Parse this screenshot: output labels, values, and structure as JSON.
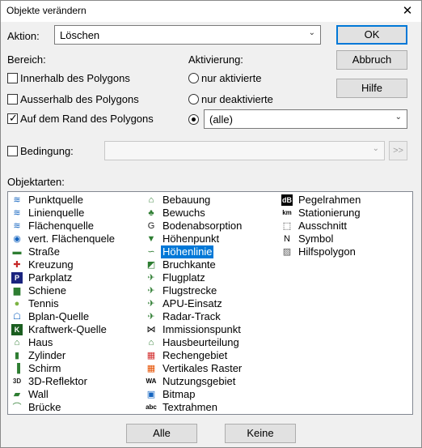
{
  "dialog": {
    "title": "Objekte verändern",
    "close_glyph": "✕"
  },
  "aktion": {
    "label": "Aktion:",
    "value": "Löschen"
  },
  "buttons": {
    "ok": "OK",
    "abbruch": "Abbruch",
    "hilfe": "Hilfe",
    "alle": "Alle",
    "keine": "Keine",
    "more": ">>"
  },
  "bereich": {
    "label": "Bereich:",
    "options": [
      {
        "label": "Innerhalb des Polygons",
        "checked": false
      },
      {
        "label": "Ausserhalb des Polygons",
        "checked": false
      },
      {
        "label": "Auf dem Rand des Polygons",
        "checked": true
      }
    ]
  },
  "aktivierung": {
    "label": "Aktivierung:",
    "options": [
      {
        "label": "nur aktivierte",
        "selected": false
      },
      {
        "label": "nur deaktivierte",
        "selected": false
      },
      {
        "label": "(alle)",
        "selected": true
      }
    ]
  },
  "bedingung": {
    "label": "Bedingung:",
    "checked": false,
    "value": ""
  },
  "objektarten": {
    "label": "Objektarten:",
    "columns": [
      [
        {
          "label": "Punktquelle",
          "icon": "radio-waves-icon"
        },
        {
          "label": "Linienquelle",
          "icon": "radio-waves-icon"
        },
        {
          "label": "Flächenquelle",
          "icon": "radio-waves-icon"
        },
        {
          "label": "vert. Flächenquele",
          "icon": "radio-waves-circle-icon"
        },
        {
          "label": "Straße",
          "icon": "car-icon"
        },
        {
          "label": "Kreuzung",
          "icon": "intersection-icon"
        },
        {
          "label": "Parkplatz",
          "icon": "parking-icon"
        },
        {
          "label": "Schiene",
          "icon": "train-icon"
        },
        {
          "label": "Tennis",
          "icon": "tennis-ball-icon"
        },
        {
          "label": "Bplan-Quelle",
          "icon": "bplan-icon"
        },
        {
          "label": "Kraftwerk-Quelle",
          "icon": "k-icon"
        },
        {
          "label": "Haus",
          "icon": "house-icon"
        },
        {
          "label": "Zylinder",
          "icon": "cylinder-icon"
        },
        {
          "label": "Schirm",
          "icon": "screen-icon"
        },
        {
          "label": "3D-Reflektor",
          "icon": "3d-reflector-icon"
        },
        {
          "label": "Wall",
          "icon": "wall-icon"
        },
        {
          "label": "Brücke",
          "icon": "bridge-icon"
        }
      ],
      [
        {
          "label": "Bebauung",
          "icon": "building-icon"
        },
        {
          "label": "Bewuchs",
          "icon": "trees-icon"
        },
        {
          "label": "Bodenabsorption",
          "icon": "ground-absorption-icon"
        },
        {
          "label": "Höhenpunkt",
          "icon": "height-point-icon"
        },
        {
          "label": "Höhenlinie",
          "icon": "contour-line-icon",
          "selected": true
        },
        {
          "label": "Bruchkante",
          "icon": "break-edge-icon"
        },
        {
          "label": "Flugplatz",
          "icon": "airplane-icon"
        },
        {
          "label": "Flugstrecke",
          "icon": "airplane-icon"
        },
        {
          "label": "APU-Einsatz",
          "icon": "airplane-icon"
        },
        {
          "label": "Radar-Track",
          "icon": "airplane-icon"
        },
        {
          "label": "Immissionspunkt",
          "icon": "immission-point-icon"
        },
        {
          "label": "Hausbeurteilung",
          "icon": "house-assessment-icon"
        },
        {
          "label": "Rechengebiet",
          "icon": "calc-area-icon"
        },
        {
          "label": "Vertikales Raster",
          "icon": "vertical-grid-icon"
        },
        {
          "label": "Nutzungsgebiet",
          "icon": "wa-icon"
        },
        {
          "label": "Bitmap",
          "icon": "bitmap-icon"
        },
        {
          "label": "Textrahmen",
          "icon": "text-frame-icon"
        }
      ],
      [
        {
          "label": "Pegelrahmen",
          "icon": "db-icon"
        },
        {
          "label": "Stationierung",
          "icon": "km-icon"
        },
        {
          "label": "Ausschnitt",
          "icon": "dashed-frame-icon"
        },
        {
          "label": "Symbol",
          "icon": "north-arrow-icon"
        },
        {
          "label": "Hilfspolygon",
          "icon": "hatched-polygon-icon"
        }
      ]
    ]
  }
}
